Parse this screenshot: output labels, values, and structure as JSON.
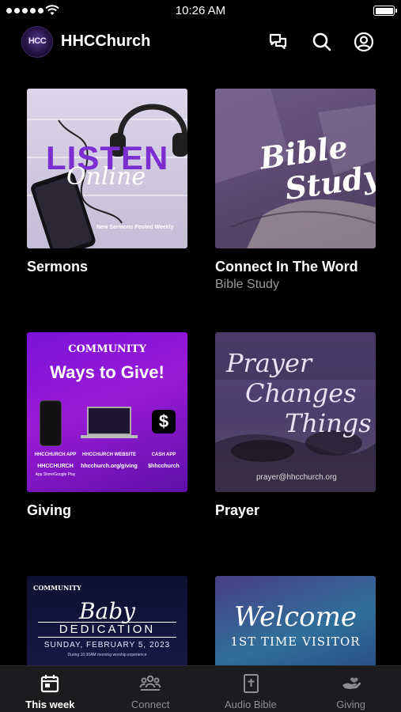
{
  "status_bar": {
    "time": "10:26 AM"
  },
  "header": {
    "title": "HHCChurch",
    "icons": [
      "chat-icon",
      "search-icon",
      "account-icon"
    ]
  },
  "cards": [
    {
      "title": "Sermons",
      "subtitle": "",
      "image": {
        "headline": "LISTEN",
        "script": "Online",
        "caption": "New Sermons Posted Weekly"
      }
    },
    {
      "title": "Connect In The Word",
      "subtitle": "Bible Study",
      "image": {
        "script_line1": "Bible",
        "script_line2": "Study"
      }
    },
    {
      "title": "Giving",
      "subtitle": "",
      "image": {
        "brand": "COMMUNITY",
        "headline": "Ways to Give!",
        "col1_title": "HHCCHURCH APP",
        "col1_sub": "HHCCHURCH",
        "col1_note": "App Store/Google Play",
        "col2_title": "HHCCHURCH WEBSITE",
        "col2_sub": "hhcchurch.org/giving",
        "col3_title": "CASH APP",
        "col3_sub": "$hhcchurch",
        "cash_symbol": "$"
      }
    },
    {
      "title": "Prayer",
      "subtitle": "",
      "image": {
        "line1": "Prayer",
        "line2": "Changes",
        "line3": "Things",
        "email": "prayer@hhcchurch.org"
      }
    },
    {
      "title": "",
      "subtitle": "",
      "image": {
        "brand": "COMMUNITY",
        "script": "Baby",
        "headline": "DEDICATION",
        "date": "SUNDAY, FEBRUARY 5, 2023",
        "note": "During 10:30AM morning worship experience"
      }
    },
    {
      "title": "",
      "subtitle": "",
      "image": {
        "script": "Welcome",
        "headline": "1ST TIME VISITOR"
      }
    }
  ],
  "tab_bar": {
    "tabs": [
      {
        "label": "This week",
        "active": true,
        "icon": "calendar-icon"
      },
      {
        "label": "Connect",
        "active": false,
        "icon": "people-icon"
      },
      {
        "label": "Audio Bible",
        "active": false,
        "icon": "bible-icon"
      },
      {
        "label": "Giving",
        "active": false,
        "icon": "giving-hand-icon"
      }
    ]
  },
  "colors": {
    "background": "#000000",
    "tab_bar": "#1c1c1e",
    "inactive_tab": "#8e8e93",
    "subtitle": "#9a9a9a"
  }
}
